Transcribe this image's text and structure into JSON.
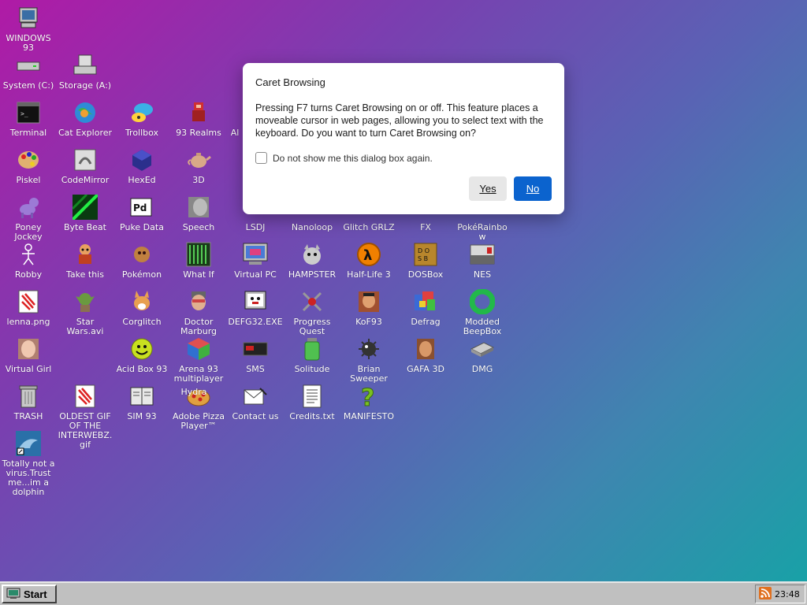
{
  "desktop": {
    "icons": [
      {
        "label": "WINDOWS 93"
      },
      {
        "label": "System (C:)"
      },
      {
        "label": "Storage (A:)"
      },
      {
        "label": "Terminal"
      },
      {
        "label": "Cat Explorer"
      },
      {
        "label": "Trollbox"
      },
      {
        "label": "93 Realms"
      },
      {
        "label": "Al"
      },
      {
        "label": "Piskel"
      },
      {
        "label": "CodeMirror"
      },
      {
        "label": "HexEd"
      },
      {
        "label": "3D"
      },
      {
        "label": "Poney Jockey"
      },
      {
        "label": "Byte Beat"
      },
      {
        "label": "Puke Data"
      },
      {
        "label": "Speech"
      },
      {
        "label": "LSDJ"
      },
      {
        "label": "Nanoloop"
      },
      {
        "label": "Glitch GRLZ"
      },
      {
        "label": "FX"
      },
      {
        "label": "PokéRainbow"
      },
      {
        "label": "Robby"
      },
      {
        "label": "Take this"
      },
      {
        "label": "Pokémon"
      },
      {
        "label": "What If"
      },
      {
        "label": "Virtual PC"
      },
      {
        "label": "HAMPSTER"
      },
      {
        "label": "Half-Life 3"
      },
      {
        "label": "DOSBox"
      },
      {
        "label": "NES"
      },
      {
        "label": "lenna.png"
      },
      {
        "label": "Star Wars.avi"
      },
      {
        "label": "Corglitch"
      },
      {
        "label": "Doctor Marburg"
      },
      {
        "label": "DEFG32.EXE"
      },
      {
        "label": "Progress Quest"
      },
      {
        "label": "KoF93"
      },
      {
        "label": "Defrag"
      },
      {
        "label": "Modded BeepBox"
      },
      {
        "label": "Virtual Girl"
      },
      {
        "label": "Acid Box 93"
      },
      {
        "label": "Arena 93 multiplayer"
      },
      {
        "label": "SMS"
      },
      {
        "label": "Solitude"
      },
      {
        "label": "Brian Sweeper"
      },
      {
        "label": "GAFA 3D"
      },
      {
        "label": "DMG"
      },
      {
        "label": "TRASH"
      },
      {
        "label": "OLDEST GIF OF THE INTERWEBZ.gif"
      },
      {
        "label": "SIM 93"
      },
      {
        "label": "Hydra"
      },
      {
        "label": "Adobe Pizza Player™"
      },
      {
        "label": "Contact us"
      },
      {
        "label": "Credits.txt"
      },
      {
        "label": "MANIFESTO"
      },
      {
        "label": "Totally not a virus.Trust me...im a dolphin"
      }
    ]
  },
  "dialog": {
    "title": "Caret Browsing",
    "message": "Pressing F7 turns Caret Browsing on or off. This feature places a moveable cursor in web pages, allowing you to select text with the keyboard. Do you want to turn Caret Browsing on?",
    "checkbox_label": "Do not show me this dialog box again.",
    "checkbox_checked": false,
    "yes_label": "Yes",
    "no_label": "No",
    "accent": "#0b63ce"
  },
  "taskbar": {
    "start_label": "Start",
    "clock": "23:48"
  }
}
